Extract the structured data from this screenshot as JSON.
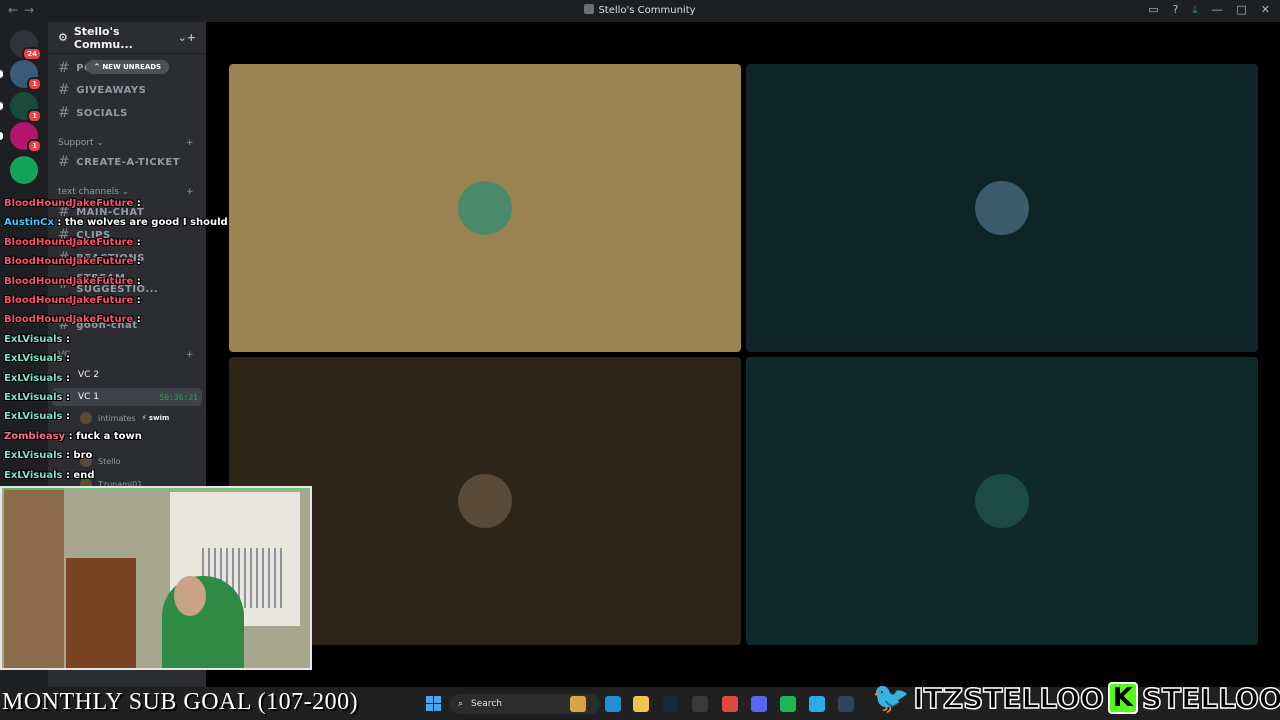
{
  "window": {
    "title": "Stello's Community",
    "nav_back": "←",
    "nav_fwd": "→"
  },
  "guilds": [
    {
      "name": "discord-home",
      "badge": "24",
      "color": "#313338"
    },
    {
      "name": "server-1",
      "badge": "1",
      "color": "#3a5a7a"
    },
    {
      "name": "server-2",
      "badge": "1",
      "color": "#1a4a3a"
    },
    {
      "name": "server-3",
      "badge": "1",
      "color": "#b4166e"
    },
    {
      "name": "server-kb",
      "badge": "",
      "color": "#13a35a"
    }
  ],
  "server": {
    "name": "Stello's Commu...",
    "new_unreads": "NEW UNREADS"
  },
  "channels": {
    "top": [
      {
        "label": "PO"
      },
      {
        "label": "GIVEAWAYS"
      },
      {
        "label": "SOCIALS"
      }
    ],
    "support_category": "Support",
    "support": [
      {
        "label": "CREATE-A-TICKET"
      }
    ],
    "text_category": "text channels",
    "text": [
      {
        "label": "MAIN-CHAT"
      },
      {
        "label": "CLIPS"
      },
      {
        "label": "REACTIONS"
      },
      {
        "label": "STREAM-SUGGESTIO..."
      },
      {
        "label": "goon-chat"
      }
    ],
    "voice_category": "VC",
    "voice": [
      {
        "label": "VC 2"
      },
      {
        "label": "VC 1",
        "time": "50:36:21"
      }
    ],
    "vc_users": [
      {
        "name": "intimates",
        "live": "⚡ swim"
      },
      {
        "name": "Stello"
      },
      {
        "name": "Tzunami01"
      }
    ]
  },
  "chat": [
    {
      "user": "BloodHoundJakeFuture",
      "msg": ":",
      "color": "#ff4d6d"
    },
    {
      "user": "AustinCx",
      "msg": ": the wolves are good I should",
      "color": "#3ad0ff"
    },
    {
      "user": "BloodHoundJakeFuture",
      "msg": ":",
      "color": "#ff4d6d"
    },
    {
      "user": "BloodHoundJakeFuture",
      "msg": ":",
      "color": "#ff4d6d"
    },
    {
      "user": "BloodHoundJakeFuture",
      "msg": ":",
      "color": "#ff4d6d"
    },
    {
      "user": "BloodHoundJakeFuture",
      "msg": ":",
      "color": "#ff4d6d"
    },
    {
      "user": "BloodHoundJakeFuture",
      "msg": ":",
      "color": "#ff4d6d"
    },
    {
      "user": "ExLVisuals",
      "msg": ":",
      "color": "#7de3c7"
    },
    {
      "user": "ExLVisuals",
      "msg": ":",
      "color": "#7de3c7"
    },
    {
      "user": "ExLVisuals",
      "msg": ":",
      "color": "#7de3c7"
    },
    {
      "user": "ExLVisuals",
      "msg": ":",
      "color": "#7de3c7"
    },
    {
      "user": "ExLVisuals",
      "msg": ":",
      "color": "#7de3c7"
    },
    {
      "user": "Zombieasy",
      "msg": ": fuck a town",
      "color": "#ff6b8a"
    },
    {
      "user": "ExLVisuals",
      "msg": ": bro",
      "color": "#7de3c7"
    },
    {
      "user": "ExLVisuals",
      "msg": ": end",
      "color": "#7de3c7"
    }
  ],
  "tiles": [
    {
      "name": "tile-1",
      "bg": "#9a8350",
      "avatar": "#4a8a6a"
    },
    {
      "name": "tile-2",
      "bg": "#0f2427",
      "avatar": "#3b5a6a"
    },
    {
      "name": "tile-3",
      "bg": "#2e2418",
      "avatar": "#5a4a3a"
    },
    {
      "name": "tile-4",
      "bg": "#0e2b27",
      "avatar": "#1c4a44"
    }
  ],
  "overlay": {
    "sub_goal": "MONTHLY SUB GOAL (107-200)",
    "twitter_handle": "ITZSTELLOO",
    "kick_letter": "K",
    "kick_handle": "STELLOOO"
  },
  "taskbar": {
    "search_label": "Search",
    "icons": [
      {
        "name": "copilot-icon",
        "color": "#d9a441"
      },
      {
        "name": "edge-icon",
        "color": "#1f8fd6"
      },
      {
        "name": "file-explorer-icon",
        "color": "#f2c14e"
      },
      {
        "name": "steam-icon",
        "color": "#1b2838"
      },
      {
        "name": "obs-icon",
        "color": "#3a3a3a"
      },
      {
        "name": "chrome-icon",
        "color": "#e04a3a"
      },
      {
        "name": "discord-icon",
        "color": "#5865f2"
      },
      {
        "name": "spotify-icon",
        "color": "#1db954"
      },
      {
        "name": "telegram-icon",
        "color": "#2aabee"
      },
      {
        "name": "steam-2-icon",
        "color": "#2a475e"
      }
    ]
  }
}
